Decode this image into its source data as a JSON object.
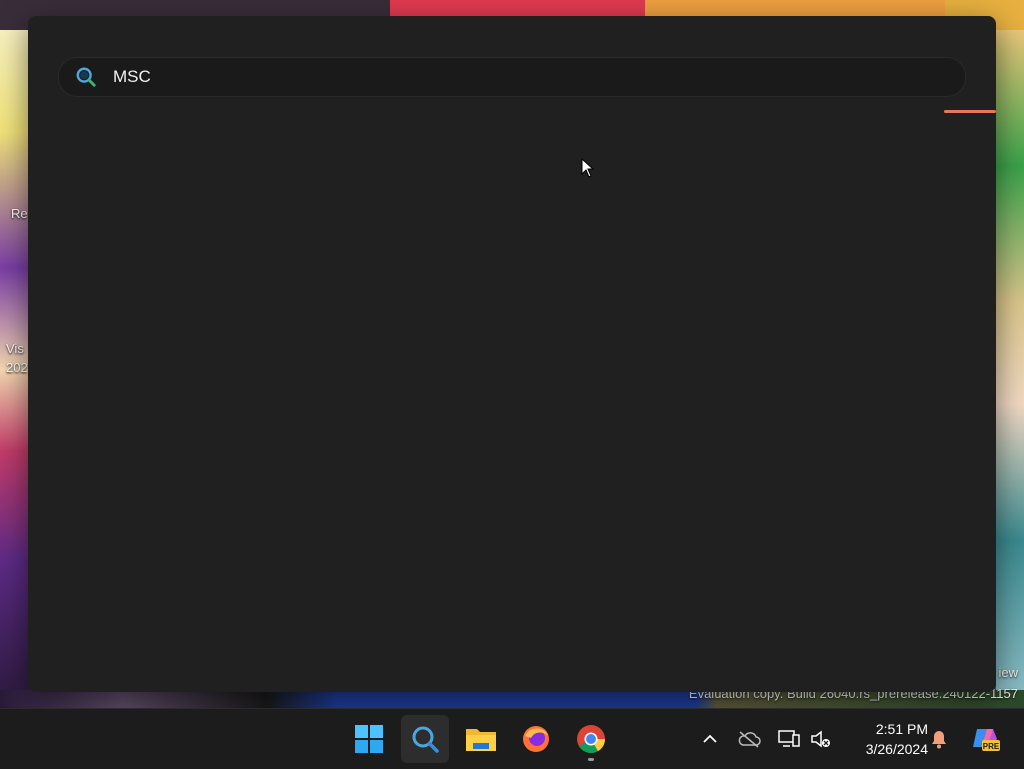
{
  "desktop": {
    "icon_labels": [
      "Re",
      "Vis",
      "202"
    ],
    "watermark_line1": "iew",
    "watermark_line2": "Evaluation copy. Build 26040.rs_prerelease.240122-1157"
  },
  "search": {
    "query": "MSC",
    "search_icon": "search-icon"
  },
  "taskbar": {
    "items": [
      {
        "name": "start-button",
        "icon": "windows-logo-icon"
      },
      {
        "name": "search-button",
        "icon": "search-icon"
      },
      {
        "name": "file-explorer-button",
        "icon": "folder-icon"
      },
      {
        "name": "firefox-button",
        "icon": "firefox-icon"
      },
      {
        "name": "chrome-button",
        "icon": "chrome-icon"
      }
    ],
    "tray": {
      "show_hidden": "chevron-up-icon",
      "onedrive": "cloud-offline-icon",
      "network": "network-icon",
      "volume": "volume-muted-icon"
    },
    "time": "2:51 PM",
    "date": "3/26/2024",
    "notifications": "bell-icon",
    "copilot": "copilot-icon",
    "copilot_badge": "PRE"
  },
  "colors": {
    "flyout_bg": "#202020",
    "accent_progress": "#e8755c",
    "taskbar_bg": "#1c1c1c"
  }
}
